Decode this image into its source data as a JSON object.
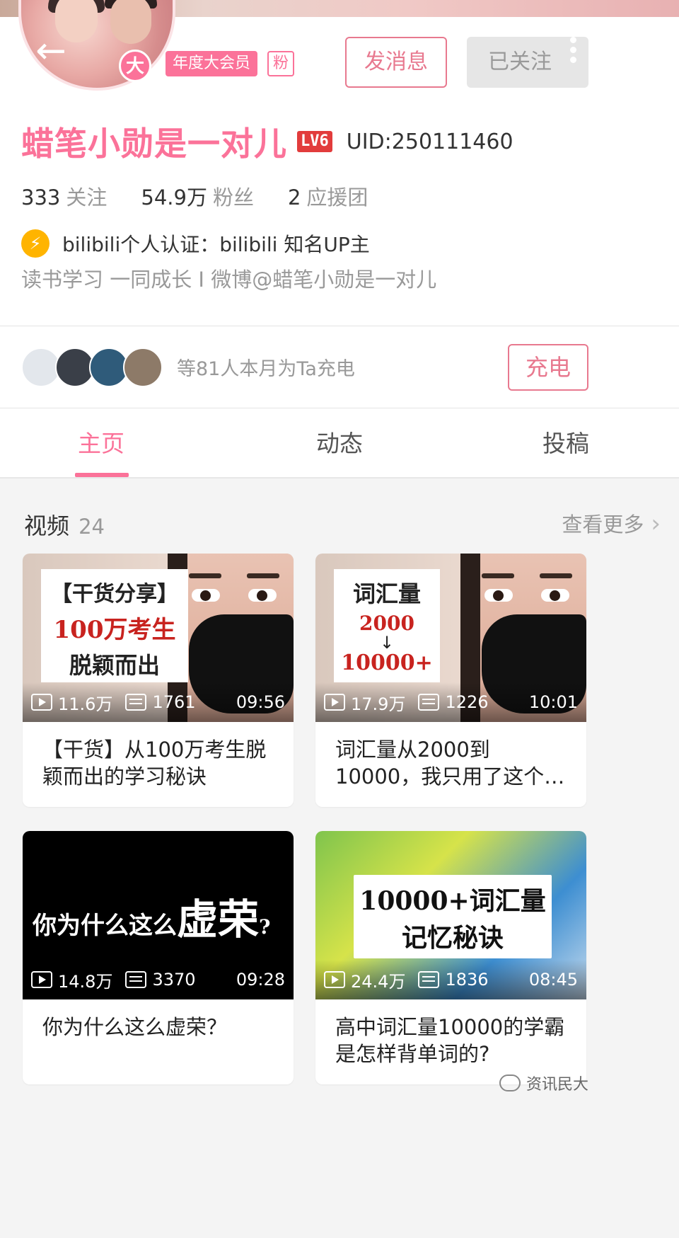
{
  "header": {
    "back_icon": "arrow-left-icon",
    "vip_badge": "大",
    "vip_tag": "年度大会员",
    "fan_tag": "粉",
    "message_button": "发消息",
    "follow_button": "已关注",
    "more_icon": "more-vertical-icon"
  },
  "profile": {
    "username": "蜡笔小勋是一对儿",
    "level": "LV6",
    "uid": "UID:250111460",
    "stats": [
      {
        "value": "333",
        "label": "关注"
      },
      {
        "value": "54.9万",
        "label": "粉丝"
      },
      {
        "value": "2",
        "label": "应援团"
      }
    ],
    "verify_icon": "lightning-icon",
    "verification": "bilibili个人认证：bilibili 知名UP主",
    "signature": "读书学习 一同成长 I 微博@蜡笔小勋是一对儿"
  },
  "charge": {
    "text": "等81人本月为Ta充电",
    "button": "充电"
  },
  "tabs": [
    {
      "label": "主页",
      "active": true
    },
    {
      "label": "动态",
      "active": false
    },
    {
      "label": "投稿",
      "active": false
    }
  ],
  "videos_section": {
    "title": "视频",
    "count": "24",
    "see_more": "查看更多",
    "items": [
      {
        "thumb_lines": [
          "【干货分享】",
          "100万考生",
          "脱颖而出"
        ],
        "views": "11.6万",
        "danmaku": "1761",
        "duration": "09:56",
        "title": "【干货】从100万考生脱颖而出的学习秘诀"
      },
      {
        "thumb_lines": [
          "词汇量",
          "2000",
          "10000+"
        ],
        "views": "17.9万",
        "danmaku": "1226",
        "duration": "10:01",
        "title": "词汇量从2000到10000，我只用了这个…"
      },
      {
        "thumb_lines": [
          "你为什么这么",
          "虚荣",
          "?"
        ],
        "views": "14.8万",
        "danmaku": "3370",
        "duration": "09:28",
        "title": "你为什么这么虚荣？"
      },
      {
        "thumb_lines": [
          "10000+词汇量",
          "记忆秘诀"
        ],
        "views": "24.4万",
        "danmaku": "1836",
        "duration": "08:45",
        "title": "高中词汇量10000的学霸是怎样背单词的?"
      }
    ]
  },
  "watermark": "资讯民大",
  "colors": {
    "accent": "#fb7299",
    "button_border": "#e8798f",
    "level_badge": "#e23c3c",
    "verify": "#ffb400"
  }
}
